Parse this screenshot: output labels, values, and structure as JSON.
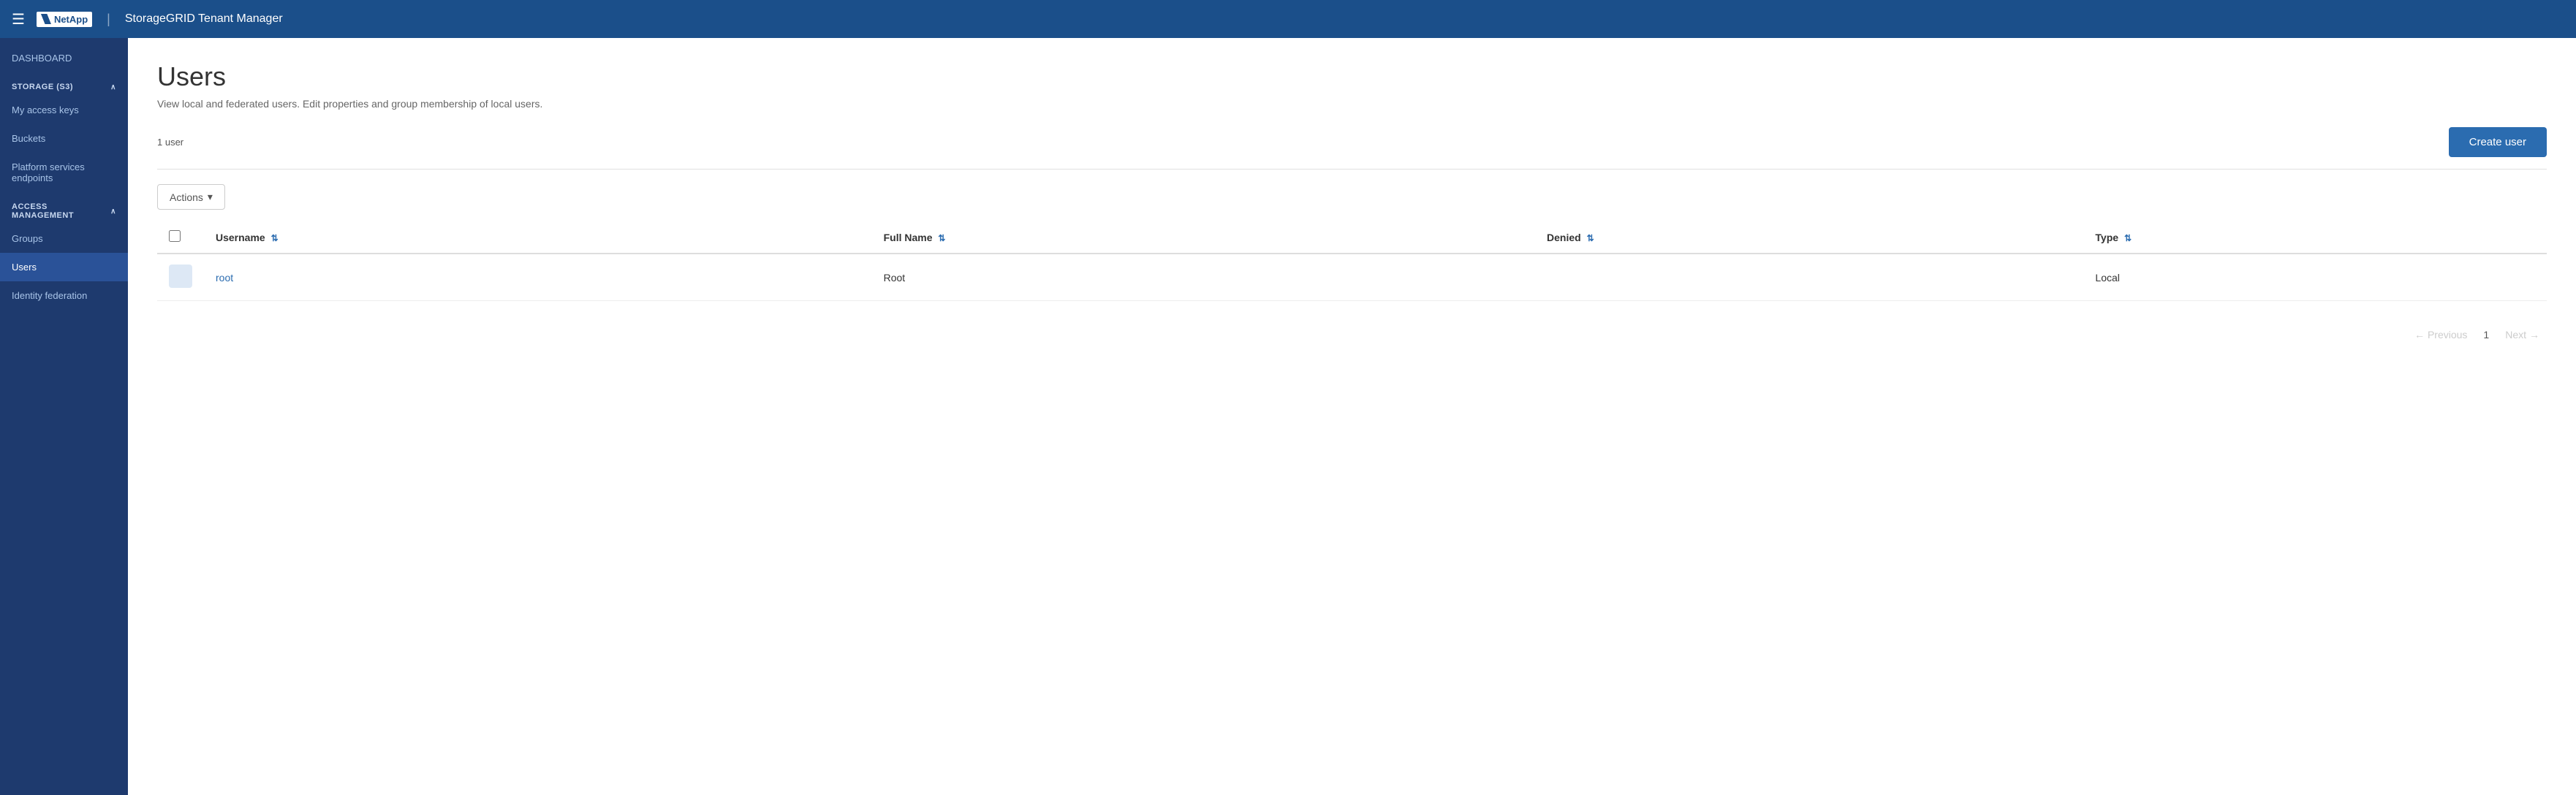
{
  "topnav": {
    "hamburger_label": "☰",
    "brand_name": "NetApp",
    "divider": "|",
    "app_title": "StorageGRID Tenant Manager"
  },
  "sidebar": {
    "dashboard_label": "DASHBOARD",
    "storage_section": "STORAGE (S3)",
    "storage_chevron": "∧",
    "storage_items": [
      {
        "id": "my-access-keys",
        "label": "My access keys"
      },
      {
        "id": "buckets",
        "label": "Buckets"
      },
      {
        "id": "platform-services-endpoints",
        "label": "Platform services endpoints"
      }
    ],
    "access_section": "ACCESS MANAGEMENT",
    "access_chevron": "∧",
    "access_items": [
      {
        "id": "groups",
        "label": "Groups"
      },
      {
        "id": "users",
        "label": "Users",
        "active": true
      },
      {
        "id": "identity-federation",
        "label": "Identity federation"
      }
    ]
  },
  "main": {
    "page_title": "Users",
    "page_subtitle": "View local and federated users. Edit properties and group membership of local users.",
    "user_count": "1 user",
    "create_user_label": "Create user",
    "actions_label": "Actions",
    "actions_chevron": "▾",
    "table": {
      "columns": [
        {
          "id": "username",
          "label": "Username",
          "sort": true
        },
        {
          "id": "fullname",
          "label": "Full Name",
          "sort": true
        },
        {
          "id": "denied",
          "label": "Denied",
          "sort": true
        },
        {
          "id": "type",
          "label": "Type",
          "sort": true
        }
      ],
      "rows": [
        {
          "id": 1,
          "username": "root",
          "fullname": "Root",
          "denied": "",
          "type": "Local"
        }
      ]
    },
    "pagination": {
      "previous_label": "Previous",
      "next_label": "Next",
      "current_page": "1",
      "prev_arrow": "←",
      "next_arrow": "→"
    }
  }
}
